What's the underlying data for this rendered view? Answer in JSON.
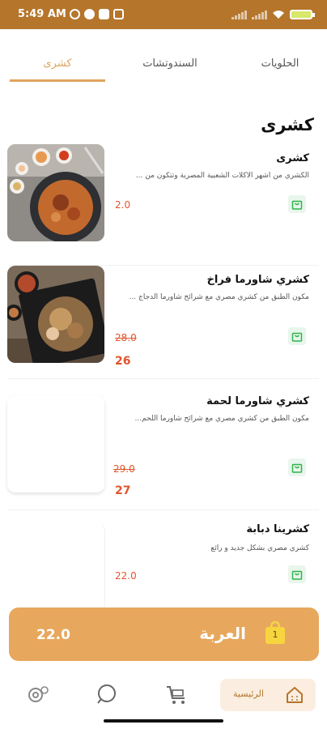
{
  "status_bar": {
    "time": "5:49 AM",
    "battery_color": "#d8e86a"
  },
  "tabs": [
    {
      "label": "الحلويات"
    },
    {
      "label": "السندوتشات"
    },
    {
      "label": "كشرى"
    }
  ],
  "section_title": "كشرى",
  "products": [
    {
      "name": "كشرى",
      "description": "الكشري من أشهر الأكلات الشعبية المصرية وتتكون من ...",
      "price": "2.0",
      "old_price": "",
      "image": "koshari-bowl-with-sides"
    },
    {
      "name": "كشري شاورما فراخ",
      "description": "مكون الطبق من كشري مصري مع شرائح شاورما الدجاج ...",
      "price": "26",
      "old_price": "28.0",
      "image": "koshari-chicken-shawarma-plate"
    },
    {
      "name": "كشري شاورما لحمة",
      "description": "مكون الطبق من كشري مصري مع شرائح شاورما اللحم...",
      "price": "27",
      "old_price": "29.0",
      "image": ""
    },
    {
      "name": "كشرينا دبابة",
      "description": "كشري مصري بشكل جديد و رائع",
      "price": "22.0",
      "old_price": "",
      "image": ""
    }
  ],
  "cart_bar": {
    "label": "العربة",
    "total": "22.0",
    "count": "1",
    "color": "#e7a75c"
  },
  "bottom_nav": {
    "home_label": "الرئيسية",
    "items": [
      "settings-icon",
      "search-icon",
      "cart-icon",
      "home-icon"
    ]
  },
  "colors": {
    "accent": "#e0a35c",
    "status_bar": "#b5752b",
    "price": "#e1552d",
    "cart_button_bg": "#e8f6ec"
  }
}
